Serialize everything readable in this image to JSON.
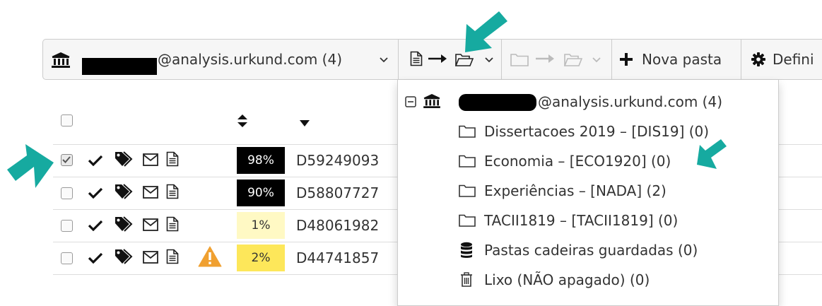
{
  "toolbar": {
    "account_suffix": "@analysis.urkund.com (4)",
    "new_folder_label": "Nova pasta",
    "settings_label": "Defini"
  },
  "documents": [
    {
      "checked": true,
      "score": "98%",
      "score_bg": "#000000",
      "score_color": "#ffffff",
      "id": "D59249093",
      "warning": false
    },
    {
      "checked": false,
      "score": "90%",
      "score_bg": "#000000",
      "score_color": "#ffffff",
      "id": "D58807727",
      "warning": false
    },
    {
      "checked": false,
      "score": "1%",
      "score_bg": "#fff9c4",
      "score_color": "#333333",
      "id": "D48061982",
      "warning": false
    },
    {
      "checked": false,
      "score": "2%",
      "score_bg": "#fde75a",
      "score_color": "#333333",
      "id": "D44741857",
      "warning": true
    }
  ],
  "dropdown": {
    "account_label": "@analysis.urkund.com (4)",
    "folders": [
      {
        "label": "Dissertacoes 2019 – [DIS19] (0)",
        "icon": "folder-icon"
      },
      {
        "label": "Economia – [ECO1920] (0)",
        "icon": "folder-icon"
      },
      {
        "label": "Experiências – [NADA] (2)",
        "icon": "folder-icon"
      },
      {
        "label": "TACII1819 – [TACII1819] (0)",
        "icon": "folder-icon"
      }
    ],
    "saved_folders_label": "Pastas cadeiras guardadas (0)",
    "trash_label": "Lixo (NÃO apagado) (0)"
  },
  "colors": {
    "annotation_arrow": "#16aaa0",
    "warning": "#f0a030",
    "toolbar_bg": "#f6f6f6"
  }
}
